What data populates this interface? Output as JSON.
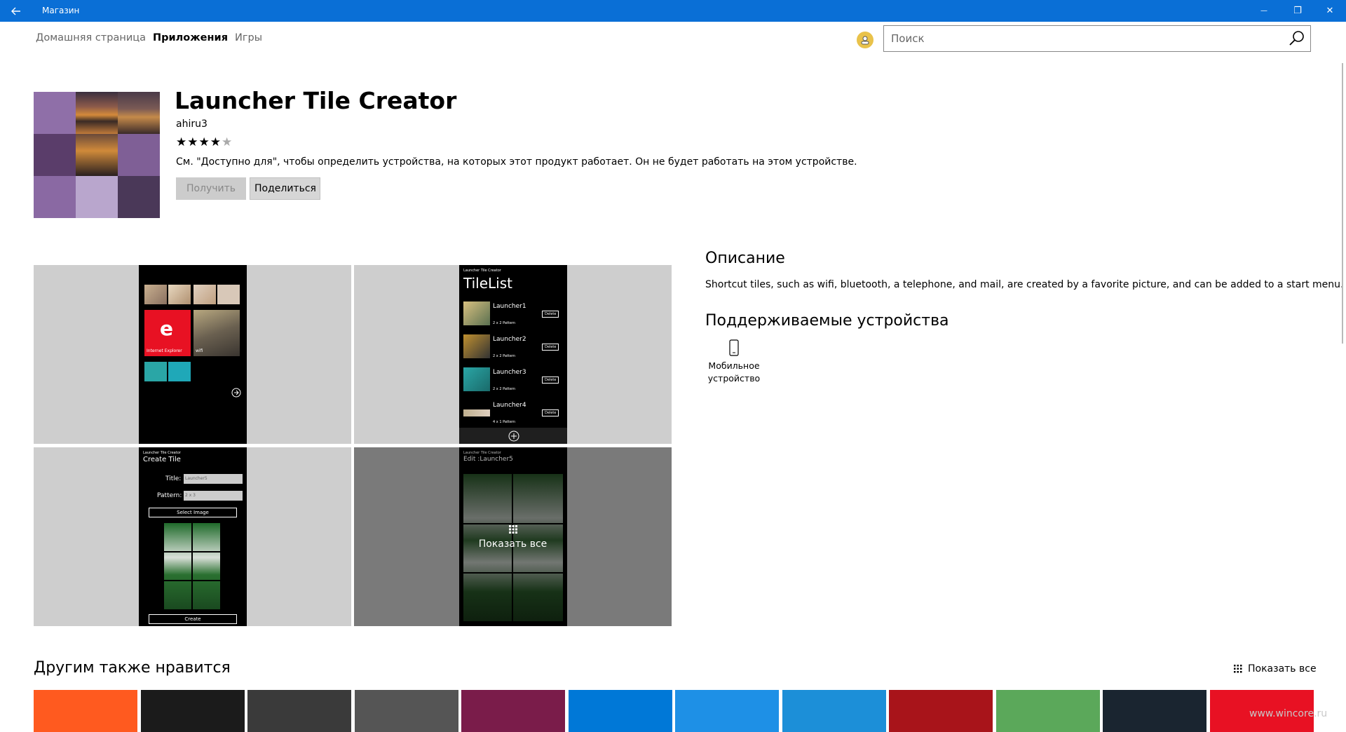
{
  "window": {
    "title": "Магазин",
    "back_icon": "back-arrow-icon",
    "minimize_glyph": "—",
    "maximize_glyph": "❐",
    "close_glyph": "✕"
  },
  "nav": {
    "items": [
      {
        "label": "Домашняя страница"
      },
      {
        "label": "Приложения"
      },
      {
        "label": "Игры"
      }
    ],
    "active_index": 1
  },
  "search": {
    "placeholder": "Поиск",
    "value": ""
  },
  "app": {
    "title": "Launcher Tile Creator",
    "publisher": "ahiru3",
    "rating": 4,
    "rating_max": 5,
    "stars_filled": "★★★★",
    "stars_empty": "★",
    "notice": "См. \"Доступно для\", чтобы определить устройства, на которых этот продукт работает. Он не будет работать на этом устройстве.",
    "get_label": "Получить",
    "share_label": "Поделиться"
  },
  "screenshots": {
    "s1": {
      "tile_ie_label": "Internet Explorer",
      "tile_wifi_label": "wifi"
    },
    "s2": {
      "header": "Launcher Tile Creator",
      "title": "TileList",
      "rows": [
        {
          "name": "Launcher1",
          "pattern": "2 x 2 Pattern",
          "delete": "Delete"
        },
        {
          "name": "Launcher2",
          "pattern": "2 x 2 Pattern",
          "delete": "Delete"
        },
        {
          "name": "Launcher3",
          "pattern": "2 x 2 Pattern",
          "delete": "Delete"
        },
        {
          "name": "Launcher4",
          "pattern": "4 x 1 Pattern",
          "delete": "Delete"
        }
      ]
    },
    "s3": {
      "header": "Launcher Tile Creator",
      "title": "Create Tile",
      "title_label": "Title:",
      "title_value": "Launcher5",
      "pattern_label": "Pattern:",
      "pattern_value": "2 x 3",
      "select_image_label": "Select Image",
      "create_label": "Create"
    },
    "s4": {
      "header": "Launcher Tile Creator",
      "title": "Edit :Launcher5",
      "show_all_label": "Показать все"
    }
  },
  "description": {
    "heading": "Описание",
    "text": "Shortcut tiles, such as wifi, bluetooth, a telephone, and mail, are created by a favorite picture, and can be added to a start menu."
  },
  "devices": {
    "heading": "Поддерживаемые устройства",
    "items": [
      {
        "line1": "Мобильное",
        "line2": "устройство",
        "icon": "mobile-phone-icon"
      }
    ]
  },
  "recommended": {
    "heading": "Другим также нравится",
    "show_all_label": "Показать все",
    "show_all_icon": "grid-icon",
    "tiles": [
      {
        "color": "#ff5a1f"
      },
      {
        "color": "#1b1b1b"
      },
      {
        "color": "#3a3a3a"
      },
      {
        "color": "#555555"
      },
      {
        "color": "#7a1c4a"
      },
      {
        "color": "#0078d7"
      },
      {
        "color": "#1e90e6"
      },
      {
        "color": "#1c8fd8"
      },
      {
        "color": "#a8141a"
      },
      {
        "color": "#5ba85a"
      },
      {
        "color": "#1a2530"
      },
      {
        "color": "#e81123"
      }
    ]
  },
  "watermark": "www.wincore.ru"
}
